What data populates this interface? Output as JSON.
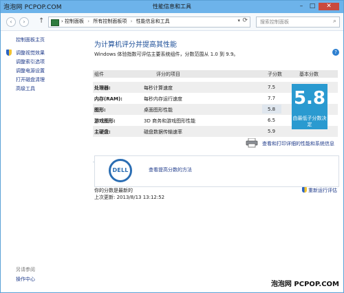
{
  "window": {
    "title": "性能信息和工具",
    "watermark_top": "泡泡网 PCPOP.COM",
    "watermark_bottom": "泡泡网 PCPOP.COM",
    "buttons": {
      "minimize": "–",
      "maximize": "□",
      "close": "✕"
    }
  },
  "nav": {
    "back": "‹",
    "forward": "›",
    "up": "↑",
    "crumbs": [
      "控制面板",
      "所有控制面板项",
      "性能信息和工具"
    ],
    "separator": "›",
    "search_placeholder": "搜索控制面板"
  },
  "sidebar": {
    "home": "控制面板主页",
    "links": [
      "调整视觉效果",
      "调整索引选项",
      "调整电源设置",
      "打开磁盘清理",
      "高级工具"
    ],
    "see_also": "另请参阅",
    "action_center": "操作中心"
  },
  "main": {
    "heading": "为计算机评分并提高其性能",
    "intro": "Windows 体验指数可评估主要系统组件，分数范围从 1.0 到 9.9。",
    "table": {
      "headers": {
        "component": "组件",
        "rated": "评分的项目",
        "subscore": "子分数",
        "base": "基本分数"
      },
      "rows": [
        {
          "component": "处理器:",
          "desc": "每秒计算速度",
          "sub": "7.5"
        },
        {
          "component": "内存(RAM):",
          "desc": "每秒内存运行速度",
          "sub": "7.7"
        },
        {
          "component": "图形:",
          "desc": "桌面图形性能",
          "sub": "5.8"
        },
        {
          "component": "游戏图形:",
          "desc": "3D 商务和游戏图形性能",
          "sub": "6.5"
        },
        {
          "component": "主硬盘:",
          "desc": "磁盘数据传输速率",
          "sub": "5.9"
        }
      ],
      "base_score": "5.8",
      "base_note_1": "由最低子分数决",
      "base_note_2": "定"
    },
    "print_link": "查看和打印详细的性能和系统信息",
    "dell": {
      "logo_text": "DELL",
      "link": "查看提高分数的方法"
    },
    "status_line1": "你的分数是最新的",
    "status_line2": "上次更新: 2013/8/13 13:12:52",
    "rerun": "重新运行评估"
  },
  "colors": {
    "titlebar": "#6db3ea",
    "score_tile": "#2a9ad0",
    "link": "#1e3a8a",
    "heading": "#1c4e98"
  },
  "icons": [
    "back-icon",
    "forward-icon",
    "up-icon",
    "control-panel-icon",
    "refresh-icon",
    "search-icon",
    "shield-icon",
    "printer-icon",
    "dell-logo",
    "help-icon"
  ]
}
